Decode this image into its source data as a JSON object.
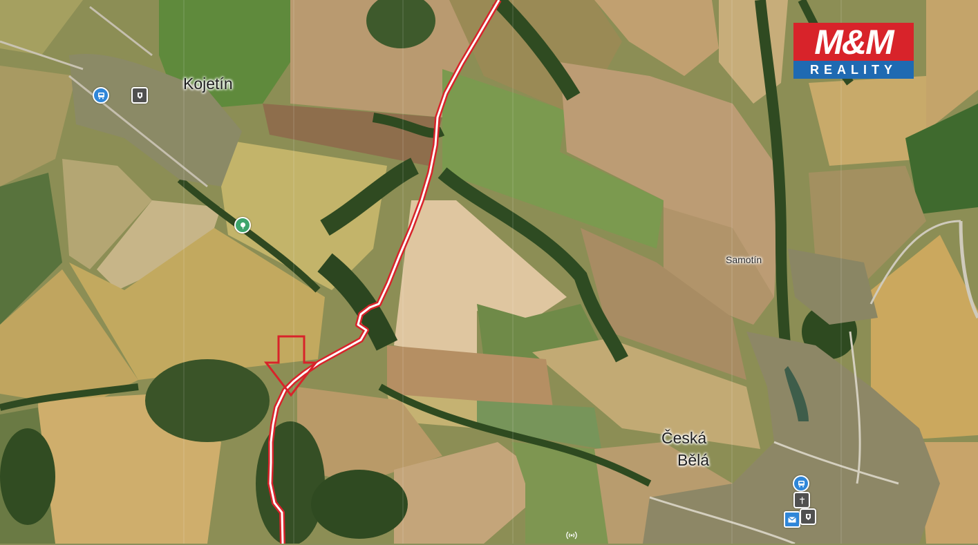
{
  "map": {
    "places": {
      "kojetin": "Kojetín",
      "samotin": "Samotín",
      "ceska_bela_line1": "Česká",
      "ceska_bela_line2": "Bělá"
    },
    "pois": [
      {
        "icon": "bus-stop-icon"
      },
      {
        "icon": "town-hall-icon"
      },
      {
        "icon": "tree-icon"
      },
      {
        "icon": "bus-stop-icon"
      },
      {
        "icon": "church-icon"
      },
      {
        "icon": "post-office-icon"
      },
      {
        "icon": "town-hall-icon"
      },
      {
        "icon": "antenna-icon"
      }
    ],
    "colors": {
      "route_outline": "#d8232a",
      "route_core": "#ffffff",
      "marker_arrow": "#d8232a"
    }
  },
  "logo": {
    "top_text": "M&M",
    "bottom_text": "REALITY",
    "top_color": "#d8232a",
    "bottom_color": "#1f6ab2"
  }
}
